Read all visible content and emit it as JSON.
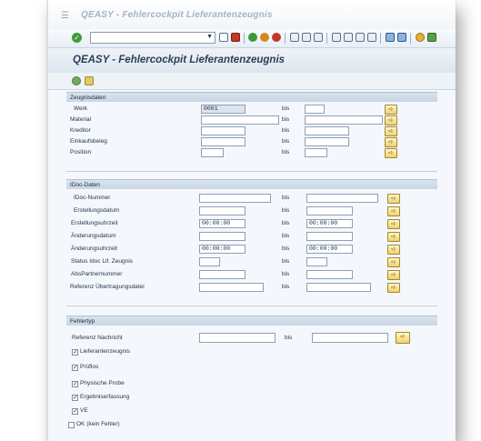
{
  "window": {
    "title": "QEASY - Fehlercockpit Lieferantenzeugnis"
  },
  "toolbar": {
    "command_value": ""
  },
  "app": {
    "title": "QEASY - Fehlercockpit Lieferantenzeugnis"
  },
  "bis_label": "bis",
  "select_button_glyph": "➪",
  "zeugnisdaten": {
    "header": "Zeugnisdaten",
    "rows": [
      {
        "label": "Werk",
        "from": "0001",
        "to": ""
      },
      {
        "label": "Material",
        "from": "",
        "to": ""
      },
      {
        "label": "Kreditor",
        "from": "",
        "to": ""
      },
      {
        "label": "Einkaufsbeleg",
        "from": "",
        "to": ""
      },
      {
        "label": "Position",
        "from": "",
        "to": ""
      }
    ]
  },
  "idoc": {
    "header": "IDoc-Daten",
    "rows": [
      {
        "label": "IDoc-Nummer",
        "from": "",
        "to": ""
      },
      {
        "label": "Erstellungsdatum",
        "from": "",
        "to": ""
      },
      {
        "label": "Erstellungsuhrzeit",
        "from": "00:00:00",
        "to": "00:00:00"
      },
      {
        "label": "Änderungsdatum",
        "from": "",
        "to": ""
      },
      {
        "label": "Änderungsuhrzeit",
        "from": "00:00:00",
        "to": "00:00:00"
      },
      {
        "label": "Status Idoc Lif. Zeugnis",
        "from": "",
        "to": ""
      },
      {
        "label": "AbsPartnernummer",
        "from": "",
        "to": ""
      },
      {
        "label": "Referenz Übertragungsdatei",
        "from": "",
        "to": ""
      }
    ]
  },
  "fehlertyp": {
    "header": "Fehlertyp",
    "referenz": {
      "label": "Referenz Nachricht",
      "from": "",
      "to": ""
    },
    "checkboxes": [
      {
        "label": "Lieferantenzeugnis",
        "checked": true
      },
      {
        "label": "Prüflos",
        "checked": true
      },
      {
        "label": "Physische Probe",
        "checked": true
      },
      {
        "label": "Ergebniserfassung",
        "checked": true
      },
      {
        "label": "VE",
        "checked": true
      },
      {
        "label": "OK (kein Fehler)",
        "checked": false
      }
    ]
  },
  "icons": {
    "ok": "check-icon",
    "execute": "execute-icon",
    "variant": "get-variant-icon"
  },
  "colors": {
    "group_header": "#c9d6e4",
    "select_button": "#eed36b",
    "title_text": "#2c3e57"
  }
}
